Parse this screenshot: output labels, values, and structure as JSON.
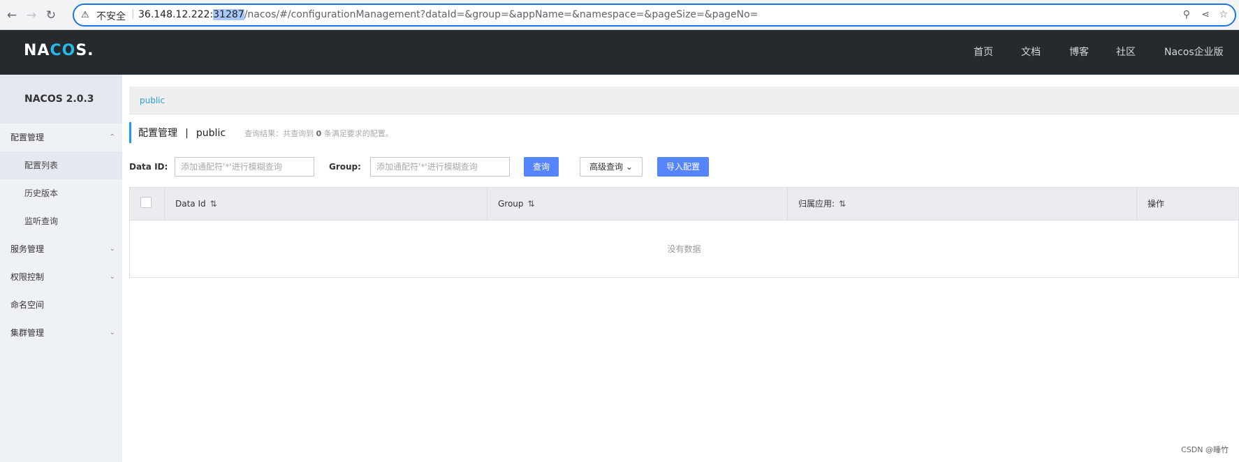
{
  "browser": {
    "security_label": "不安全",
    "url_host": "36.148.12.222:",
    "url_port": "31287",
    "url_path": "/nacos/#/configurationManagement?dataId=&group=&appName=&namespace=&pageSize=&pageNo="
  },
  "header": {
    "logo_prefix": "NA",
    "logo_accent": "CO",
    "logo_suffix": "S.",
    "nav": [
      "首页",
      "文档",
      "博客",
      "社区",
      "Nacos企业版"
    ]
  },
  "sidebar": {
    "version": "NACOS 2.0.3",
    "groups": [
      {
        "label": "配置管理",
        "items": [
          "配置列表",
          "历史版本",
          "监听查询"
        ]
      },
      {
        "label": "服务管理"
      },
      {
        "label": "权限控制"
      },
      {
        "label": "命名空间"
      },
      {
        "label": "集群管理"
      }
    ]
  },
  "main": {
    "breadcrumb": "public",
    "title": "配置管理",
    "title_sep": "|",
    "namespace": "public",
    "result_prefix": "查询结果：共查询到",
    "result_count": "0",
    "result_suffix": "条满足要求的配置。",
    "dataid_label": "Data ID:",
    "dataid_placeholder": "添加通配符'*'进行模糊查询",
    "group_label": "Group:",
    "group_placeholder": "添加通配符'*'进行模糊查询",
    "query_button": "查询",
    "advanced_button": "高级查询",
    "import_button": "导入配置",
    "table": {
      "columns": [
        "Data Id",
        "Group",
        "归属应用:",
        "操作"
      ],
      "empty_text": "没有数据"
    }
  },
  "footer_watermark": "CSDN @睡竹",
  "colors": {
    "header_bg": "#252a2f",
    "sidebar_bg": "#eef1f6",
    "primary": "#5584ff",
    "link": "#2a9bd5"
  }
}
